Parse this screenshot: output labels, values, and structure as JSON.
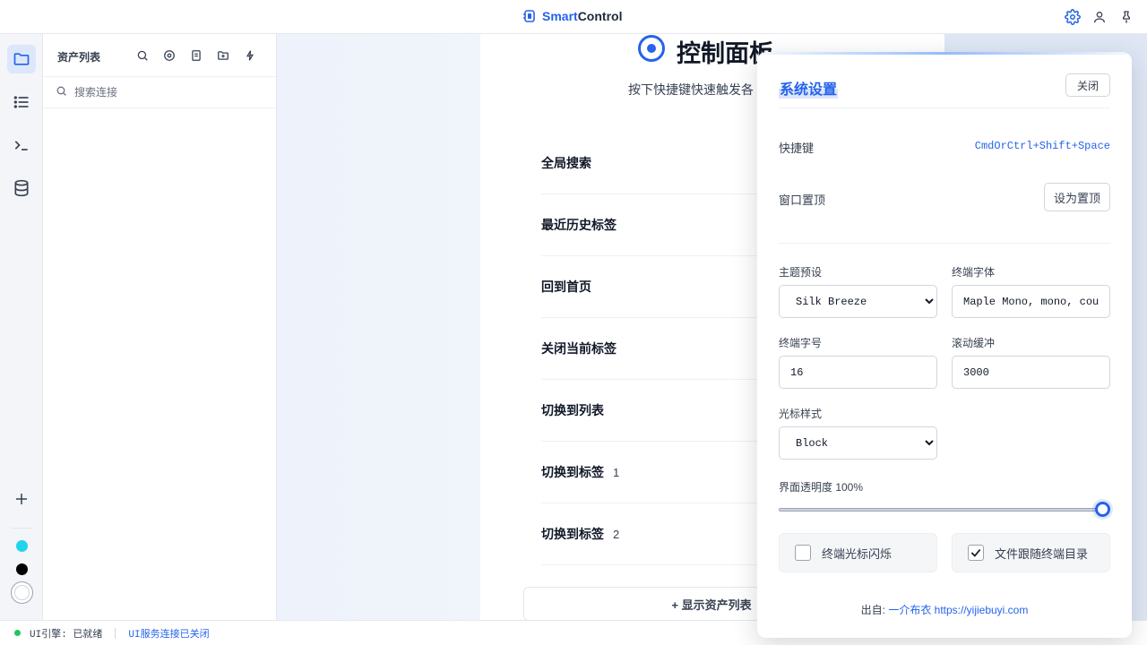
{
  "app": {
    "brand_part1": "Smart",
    "brand_part2": "Control"
  },
  "topbar": {
    "icons": [
      "gear-icon",
      "user-icon",
      "pin-icon"
    ]
  },
  "rail": {
    "items": [
      "folder-icon",
      "list-icon",
      "terminal-icon",
      "database-icon"
    ],
    "add": "plus-icon",
    "theme_colors": [
      "#22d3ee",
      "#000000",
      "#ffffff"
    ]
  },
  "assets": {
    "title": "资产列表",
    "search_placeholder": "搜索连接"
  },
  "control_panel": {
    "title": "控制面板",
    "subtitle": "按下快捷键快速触发各",
    "shortcuts": [
      {
        "label": "全局搜索",
        "num": ""
      },
      {
        "label": "最近历史标签",
        "num": ""
      },
      {
        "label": "回到首页",
        "num": ""
      },
      {
        "label": "关闭当前标签",
        "num": ""
      },
      {
        "label": "切换到列表",
        "num": ""
      },
      {
        "label": "切换到标签",
        "num": "1"
      },
      {
        "label": "切换到标签",
        "num": "2"
      }
    ],
    "show_assets": "+ 显示资产列表"
  },
  "settings": {
    "title": "系统设置",
    "close": "关闭",
    "hotkey_label": "快捷键",
    "hotkey_value": "CmdOrCtrl+Shift+Space",
    "pin_label": "窗口置顶",
    "pin_button": "设为置顶",
    "theme_label": "主题预设",
    "theme_value": "Silk Breeze",
    "font_label": "终端字体",
    "font_value": "Maple Mono, mono, courier",
    "fontsize_label": "终端字号",
    "fontsize_value": "16",
    "scroll_label": "滚动缓冲",
    "scroll_value": "3000",
    "cursor_label": "光标样式",
    "cursor_value": "Block",
    "opacity_label": "界面透明度 100%",
    "opacity_value": 1.0,
    "blink_label": "终端光标闪烁",
    "blink_checked": false,
    "follow_label": "文件跟随终端目录",
    "follow_checked": true,
    "credit_prefix": "出自: ",
    "credit_link": "一介布衣 https://yijiebuyi.com",
    "accent": "#2563eb"
  },
  "status": {
    "engine": "UI引擎: 已就绪",
    "service": "UI服务连接已关闭"
  }
}
